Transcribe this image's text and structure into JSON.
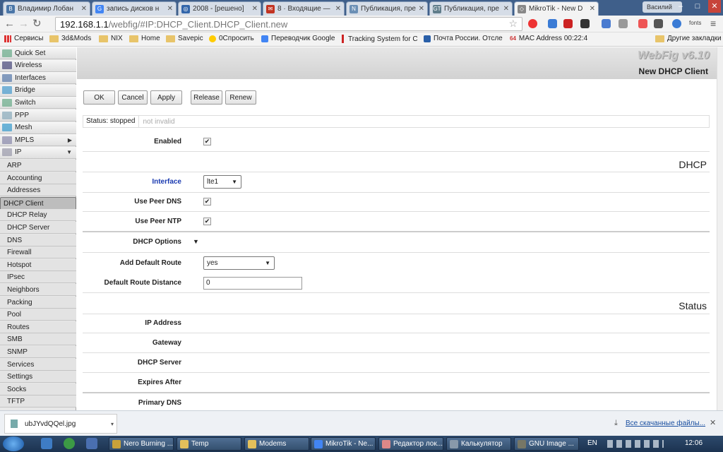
{
  "browser": {
    "tabs": [
      {
        "title": "Владимир Лобан",
        "fav": "В",
        "color": "#4a76a8"
      },
      {
        "title": "запись дисков н",
        "fav": "G",
        "color": "#4285f4"
      },
      {
        "title": "2008 - [решено]",
        "fav": "◎",
        "color": "#3366aa"
      },
      {
        "title": "8 · Входящие —",
        "fav": "✉",
        "color": "#c23321"
      },
      {
        "title": "Публикация, пре",
        "fav": "N",
        "color": "#6b8fb5"
      },
      {
        "title": "Публикация, пре",
        "fav": "GT",
        "color": "#607d8b"
      },
      {
        "title": "MikroTik - New D",
        "fav": "◇",
        "color": "#888"
      }
    ],
    "user": "Василий",
    "url_host": "192.168.1.1",
    "url_path": "/webfig/#IP:DHCP_Client.DHCP_Client.new",
    "fonts_label": "fonts",
    "bookmarks": [
      "Сервисы",
      "3d&Mods",
      "NIX",
      "Home",
      "Savepic",
      "0Спросить",
      "Переводчик Google",
      "Tracking System for C",
      "Почта России. Отсле",
      "MAC Address 00:22:4"
    ],
    "other_bookmarks": "Другие закладки"
  },
  "menu": {
    "items": [
      {
        "label": "Quick Set",
        "icon": "quickset-icon"
      },
      {
        "label": "Wireless",
        "icon": "wireless-icon"
      },
      {
        "label": "Interfaces",
        "icon": "interfaces-icon"
      },
      {
        "label": "Bridge",
        "icon": "bridge-icon"
      },
      {
        "label": "Switch",
        "icon": "switch-icon"
      },
      {
        "label": "PPP",
        "icon": "ppp-icon"
      },
      {
        "label": "Mesh",
        "icon": "mesh-icon"
      },
      {
        "label": "MPLS",
        "icon": "mpls-icon",
        "arrow": "▶"
      },
      {
        "label": "IP",
        "icon": "ip-icon",
        "arrow": "▼"
      }
    ],
    "ip_sub": [
      "ARP",
      "Accounting",
      "Addresses",
      "DHCP Client",
      "DHCP Relay",
      "DHCP Server",
      "DNS",
      "Firewall",
      "Hotspot",
      "IPsec",
      "Neighbors",
      "Packing",
      "Pool",
      "Routes",
      "SMB",
      "SNMP",
      "Services",
      "Settings",
      "Socks",
      "TFTP"
    ],
    "selected_sub": "DHCP Client"
  },
  "header": {
    "brand": "WebFig v6.10",
    "title": "New DHCP Client"
  },
  "buttons": {
    "ok": "OK",
    "cancel": "Cancel",
    "apply": "Apply",
    "release": "Release",
    "renew": "Renew"
  },
  "status": {
    "text": "Status: stopped",
    "extra": "not invalid"
  },
  "form": {
    "enabled_label": "Enabled",
    "dhcp_section": "DHCP",
    "interface_label": "Interface",
    "interface_value": "lte1",
    "use_peer_dns_label": "Use Peer DNS",
    "use_peer_ntp_label": "Use Peer NTP",
    "dhcp_options_label": "DHCP Options",
    "add_default_route_label": "Add Default Route",
    "add_default_route_value": "yes",
    "default_route_distance_label": "Default Route Distance",
    "default_route_distance_value": "0",
    "status_section": "Status",
    "ip_address_label": "IP Address",
    "gateway_label": "Gateway",
    "dhcp_server_label": "DHCP Server",
    "expires_after_label": "Expires After",
    "primary_dns_label": "Primary DNS"
  },
  "downloads": {
    "file": "ubJYvdQQel.jpg",
    "all": "Все скачанные файлы..."
  },
  "taskbar": {
    "items": [
      {
        "label": "Nero Burning ...",
        "color": "#c9a23a"
      },
      {
        "label": "Temp",
        "color": "#e3c05b"
      },
      {
        "label": "Modems",
        "color": "#e3c05b"
      },
      {
        "label": "MikroTik - Ne...",
        "color": "#4285f4"
      },
      {
        "label": "Редактор лок...",
        "color": "#d88"
      },
      {
        "label": "Калькулятор",
        "color": "#89a"
      },
      {
        "label": "GNU Image ...",
        "color": "#776"
      }
    ],
    "lang": "EN",
    "time": "12:06"
  }
}
